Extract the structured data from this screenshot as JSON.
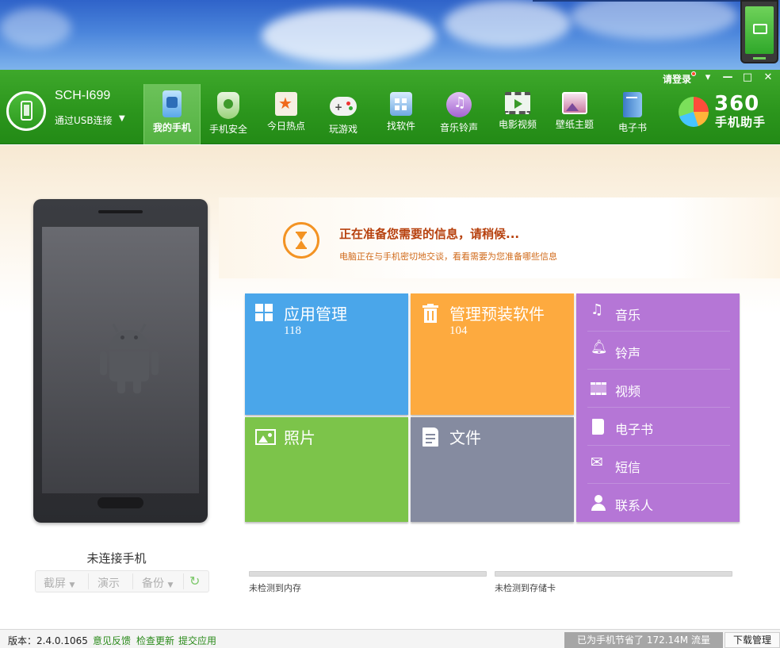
{
  "header": {
    "device_name": "SCH-I699",
    "connection": "通过USB连接",
    "login": "请登录",
    "brand_number": "360",
    "brand_sub": "手机助手",
    "nav": [
      {
        "label": "我的手机",
        "icon": "my-phone-icon",
        "active": true
      },
      {
        "label": "手机安全",
        "icon": "shield-icon"
      },
      {
        "label": "今日热点",
        "icon": "hot-star-icon"
      },
      {
        "label": "玩游戏",
        "icon": "gamepad-icon"
      },
      {
        "label": "找软件",
        "icon": "software-bag-icon"
      },
      {
        "label": "音乐铃声",
        "icon": "music-note-icon"
      },
      {
        "label": "电影视频",
        "icon": "film-icon"
      },
      {
        "label": "壁纸主题",
        "icon": "wallpaper-icon"
      },
      {
        "label": "电子书",
        "icon": "book-icon"
      }
    ]
  },
  "phone": {
    "status": "未连接手机",
    "actions": {
      "screenshot": "截屏",
      "demo": "演示",
      "backup": "备份"
    }
  },
  "banner": {
    "title": "正在准备您需要的信息，请稍候...",
    "subtitle": "电脑正在与手机密切地交谈，看看需要为您准备哪些信息"
  },
  "tiles": {
    "apps": {
      "title": "应用管理",
      "count": "118"
    },
    "preinstalled": {
      "title": "管理预装软件",
      "count": "104"
    },
    "photos": {
      "title": "照片"
    },
    "files": {
      "title": "文件"
    },
    "media": [
      {
        "label": "音乐",
        "icon": "music-note-icon"
      },
      {
        "label": "铃声",
        "icon": "bell-icon"
      },
      {
        "label": "视频",
        "icon": "film-icon"
      },
      {
        "label": "电子书",
        "icon": "book-icon"
      },
      {
        "label": "短信",
        "icon": "envelope-icon"
      },
      {
        "label": "联系人",
        "icon": "person-icon"
      }
    ]
  },
  "storage": {
    "memory": "未检测到内存",
    "sdcard": "未检测到存储卡"
  },
  "statusbar": {
    "version": "版本：2.4.0.1065",
    "feedback": "意见反馈",
    "check_update": "检查更新",
    "submit_app": "提交应用",
    "saved": "已为手机节省了 172.14M 流量",
    "download_manager": "下载管理"
  },
  "colors": {
    "header_green": "#2c961d",
    "apps_tile": "#4aa6ea",
    "preinstalled_tile": "#fdaa3f",
    "photos_tile": "#7cc44a",
    "files_tile": "#858ba0",
    "media_tile": "#b576d6",
    "banner_title": "#b7410e"
  }
}
